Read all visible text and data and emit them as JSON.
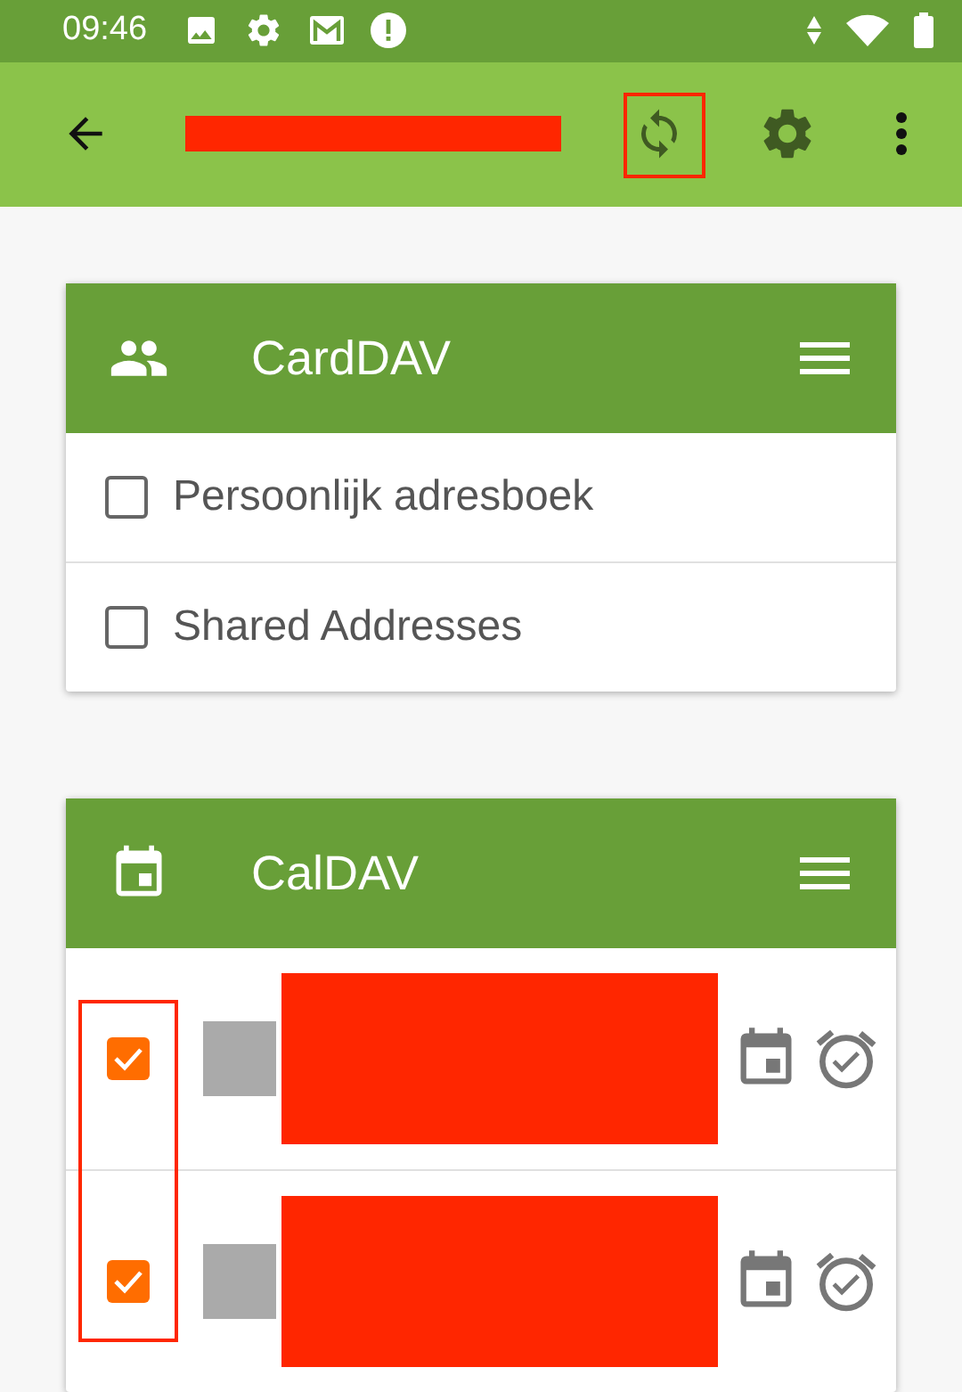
{
  "status_bar": {
    "time": "09:46"
  },
  "cards": [
    {
      "kind": "contacts",
      "title": "CardDAV",
      "items": [
        {
          "kind": "addressbook",
          "label": "Persoonlijk adresboek",
          "checked": false
        },
        {
          "kind": "addressbook",
          "label": "Shared Addresses",
          "checked": false
        }
      ]
    },
    {
      "kind": "calendar",
      "title": "CalDAV",
      "items": [
        {
          "kind": "calendar",
          "checked": true,
          "color": "#aaaaaa"
        },
        {
          "kind": "calendar",
          "checked": true,
          "color": "#aaaaaa"
        }
      ]
    }
  ]
}
